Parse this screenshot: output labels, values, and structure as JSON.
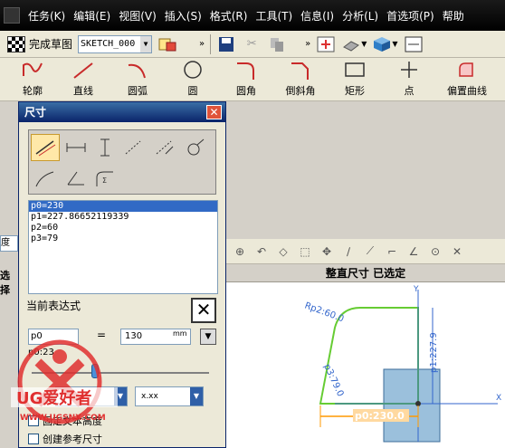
{
  "menu": {
    "items": [
      "任务(K)",
      "编辑(E)",
      "视图(V)",
      "插入(S)",
      "格式(R)",
      "工具(T)",
      "信息(I)",
      "分析(L)",
      "首选项(P)",
      "帮助"
    ]
  },
  "toolbar": {
    "finish_sketch_label": "完成草图",
    "sketch_name": "SKETCH_000"
  },
  "curve_tools": [
    "轮廓",
    "直线",
    "圆弧",
    "圆",
    "圆角",
    "倒斜角",
    "矩形",
    "点",
    "偏置曲线"
  ],
  "left_strip": {
    "label1": "度",
    "label2": "选择"
  },
  "dialog": {
    "title": "尺寸",
    "expressions": [
      "p0=230",
      "p1=227.86652119339",
      "p2=60",
      "p3=79"
    ],
    "current_expr_label": "当前表达式",
    "name_value": "p0",
    "equals": "=",
    "value": "130",
    "unit": "mm",
    "small_text": "p0:23",
    "style_option": "x.xx",
    "checkbox1_label": "固定文本高度",
    "checkbox2_label": "创建参考尺寸"
  },
  "status": {
    "text": "整直尺寸 已选定"
  },
  "canvas": {
    "dim_p0": "p0:230.0",
    "dim_p1": "p1:227.9",
    "dim_p2": "Rp2:60.0",
    "dim_p3": "p3:79.0",
    "axis_y": "Y",
    "axis_x": "X"
  },
  "watermark": {
    "brand": "UG爱好者",
    "url": "WWW.UGSNX.COM"
  },
  "colors": {
    "selected_dim": "#ff9900",
    "sketch_line": "#66cc33",
    "constraint_dim": "#3366cc",
    "title_bar": "#0a246a"
  }
}
